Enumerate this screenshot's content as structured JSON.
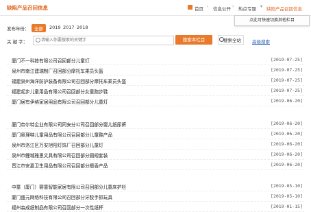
{
  "header": {
    "logo": "缺陷产品召回信息",
    "breadcrumb": [
      "首页",
      "信息公开",
      "热点专题",
      "缺陷产品召回信息"
    ],
    "tooltip": "点此可快速切换其他栏目"
  },
  "filter": {
    "label": "发布年份：",
    "years": [
      "全部",
      "2019",
      "2017",
      "2018"
    ],
    "active": 0
  },
  "search": {
    "label": "关 键 字：",
    "placeholder": "请输入你要搜索的关键字",
    "btn_column": "搜索本栏目",
    "btn_all": "搜索全站",
    "advanced": "高级搜索"
  },
  "items": [
    {
      "title": "厦门不一科技有限公司召回部分儿童灯",
      "date": "[2019-07-25]"
    },
    {
      "title": "泉州市南江建瑞制厂召回部分摩托车乘员头盔",
      "date": "[2019-07-25]"
    },
    {
      "title": "福建泉州海洋防护装备有限公司召回部分摩托车乘员头盔",
      "date": "[2019-07-25]"
    },
    {
      "title": "福建起步儿童用品有限公司召回部分女童跑步鞋",
      "date": "[2019-07-25]"
    },
    {
      "title": "厦门居有伊格家居用品有限公司召回部分儿童灯",
      "date": "[2019-06-20]"
    },
    {
      "title": "厦门帝尔特企业有限公司同安分公司召回部分婴儿纸尿裤",
      "date": "[2019-06-20]"
    },
    {
      "title": "厦门奥理特儿童用品有限公司召回部分儿童鞋产品",
      "date": "[2019-06-20]"
    },
    {
      "title": "泉州市洛江区万安旭阳灯饰厂召回部分儿童灯",
      "date": "[2019-06-20]"
    },
    {
      "title": "泉州市鲤城雅思文具有限公司召回部分圆规套装",
      "date": "[2019-06-20]"
    },
    {
      "title": "晋江市安嘉卫生用品有限公司召回部分檀香产品",
      "date": "[2019-06-20]"
    },
    {
      "title": "中童（厦门）婴童智能家居有限公司召回部分儿童床护栏",
      "date": "[2019-05-10]"
    },
    {
      "title": "厦门盛元网络科技有限公司召回部分牙胶手抓玩具",
      "date": "[2019-05-10]"
    },
    {
      "title": "福州森成纸制品有限公司召回部分一次性纸杯",
      "date": "[2019-01-15]"
    }
  ]
}
